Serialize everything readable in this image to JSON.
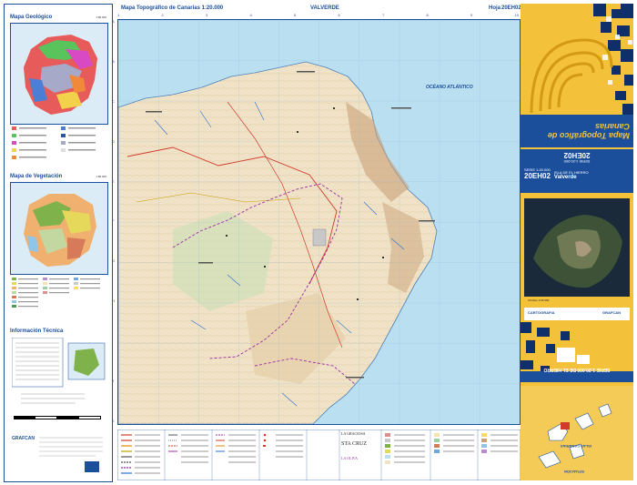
{
  "left_panel": {
    "geologic_title": "Mapa Geológico",
    "geologic_scale": "1:80.000",
    "vegetation_title": "Mapa de Vegetación",
    "vegetation_scale": "1:80.000",
    "info_title": "Información Técnica",
    "grafcan_label": "GRAFCAN"
  },
  "header": {
    "map_title": "Mapa Topográfico de Canarias 1:20.000",
    "sheet_name": "VALVERDE",
    "sheet_label": "Hoja",
    "sheet_code": "20EH02"
  },
  "map": {
    "ocean_label": "OCÉANO ATLÁNTICO",
    "columns": [
      "1",
      "2",
      "3",
      "4",
      "5",
      "6",
      "7",
      "8",
      "9",
      "10"
    ],
    "rows": [
      "A",
      "B",
      "C",
      "D",
      "E",
      "F",
      "G",
      "H",
      "I",
      "J",
      "K"
    ]
  },
  "right_panel": {
    "cover_title": "Mapa Topográfico de Canarias",
    "series": "SERIE 1:20.000",
    "island": "ISLA DE EL HIERRO",
    "sheet_code": "20EH02",
    "sheet_name": "Valverde",
    "ortho_caption": "Ortofoto 1:65.000",
    "bottom_series": "SERIE 1:20.000 DE EL HIERRO",
    "situation_label": "SITUACIÓN",
    "islands_label": "ISLAS CANARIAS",
    "logos": [
      "CARTOGRAFIA",
      "GRAFCAN"
    ]
  },
  "bottom_legend": {
    "place_names": [
      "LA GRACIOSA",
      "STA CRUZ",
      "LA OLIVA"
    ]
  },
  "colors": {
    "frame_blue": "#1b4f9c",
    "ocean": "#b9dff1",
    "land": "#f0e2c6",
    "panel_yellow": "#f3c23a",
    "dark_blue": "#0f2f6b"
  }
}
